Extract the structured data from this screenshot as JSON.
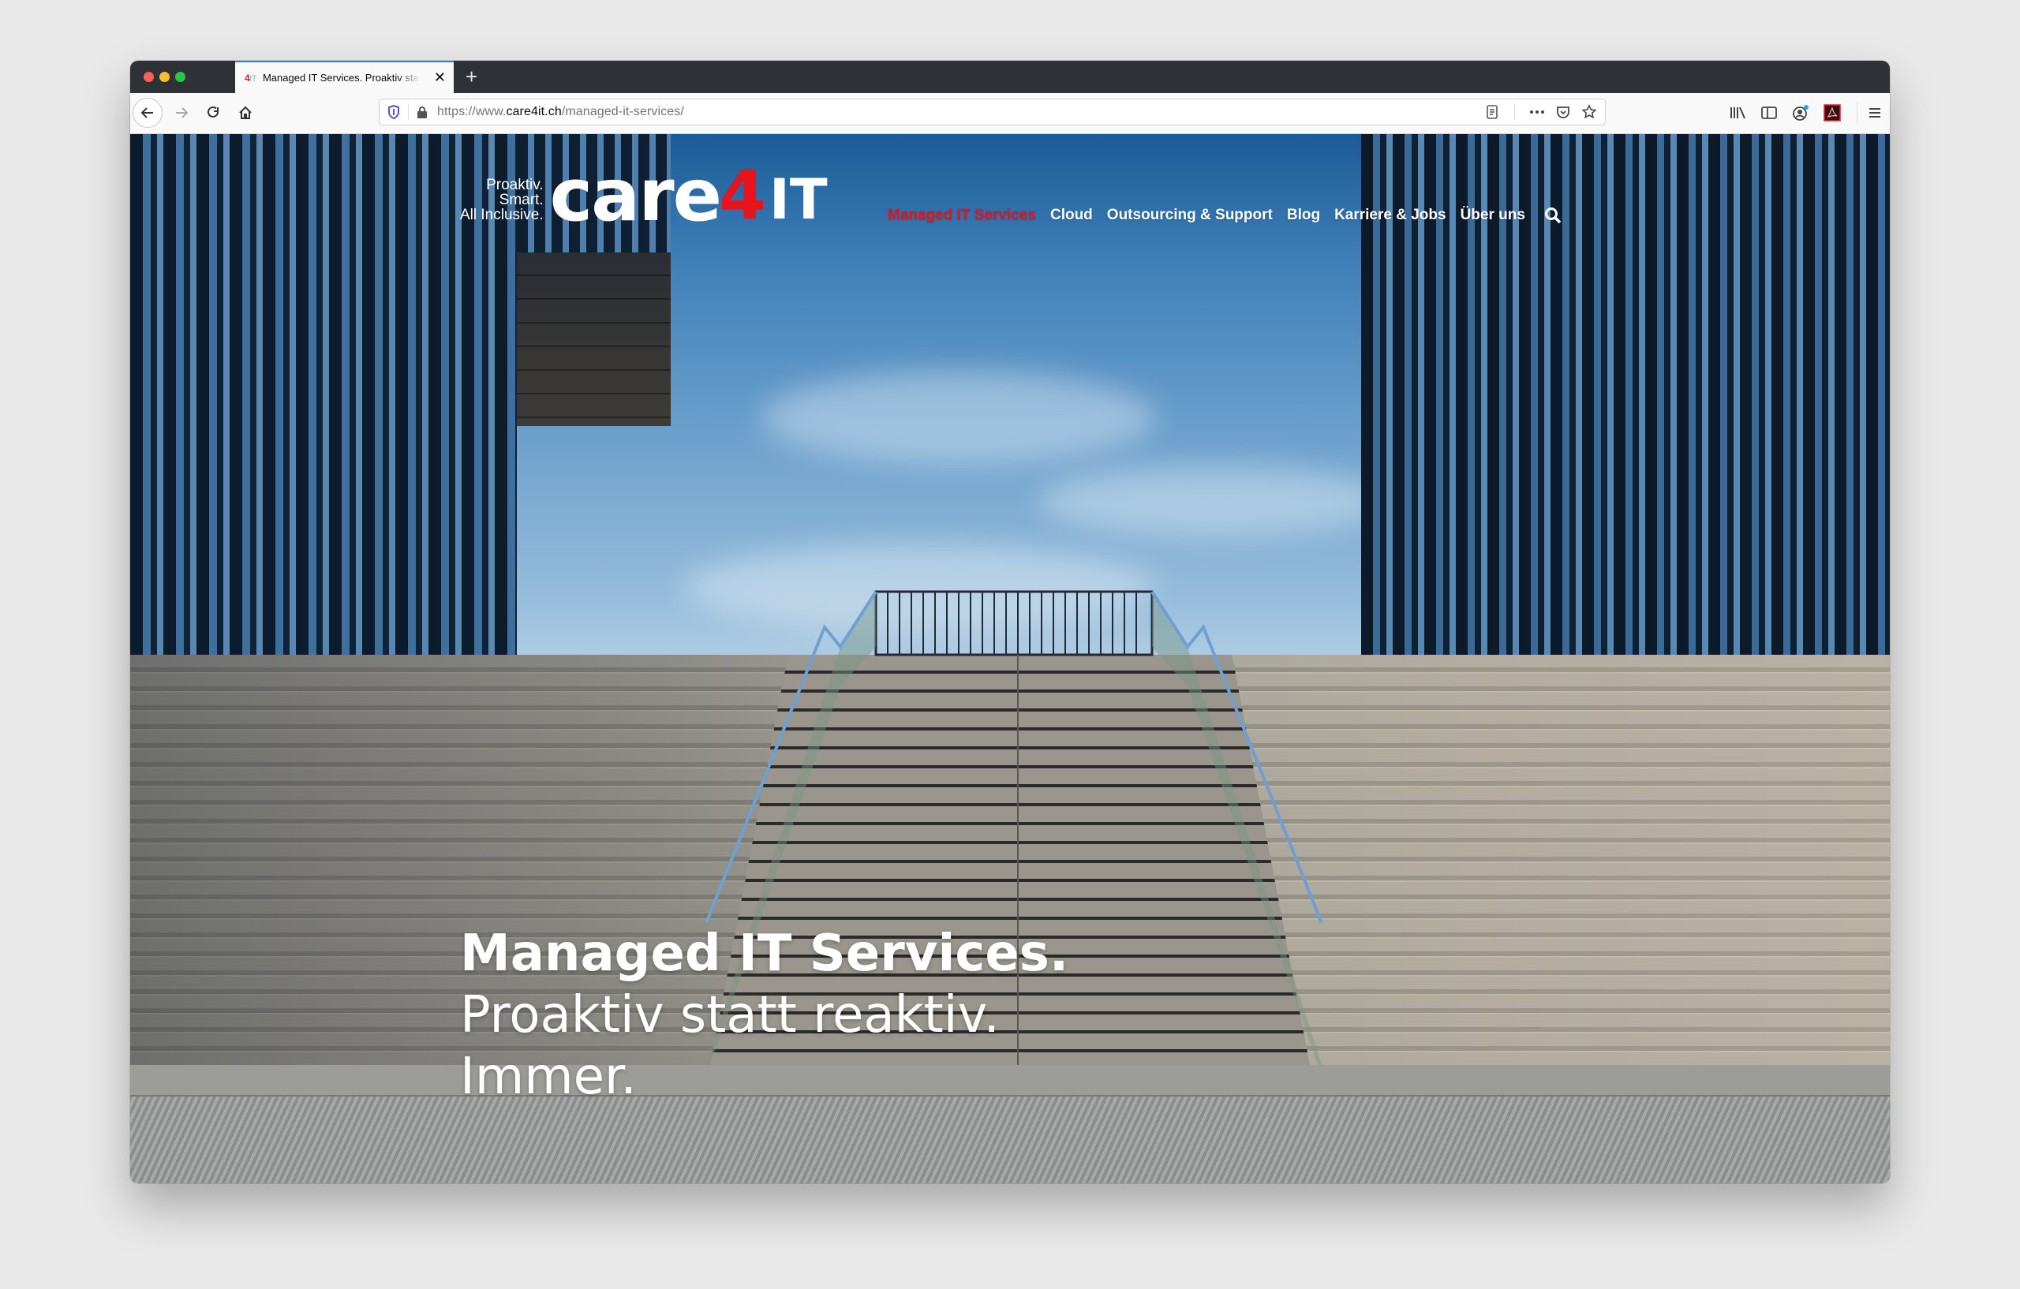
{
  "browser": {
    "tab": {
      "favicon_four": "4",
      "favicon_it": "IT",
      "title": "Managed IT Services. Proaktiv statt reaktiv. Immer."
    },
    "new_tab_label": "+",
    "close_label": "✕",
    "url": {
      "prefix": "https://www.",
      "domain": "care4it.ch",
      "path": "/managed-it-services/"
    }
  },
  "site": {
    "logo": {
      "tagline": [
        "Proaktiv.",
        "Smart.",
        "All Inclusive."
      ],
      "care": "care",
      "four": "4",
      "it": "IT"
    },
    "nav": [
      {
        "label": "Managed IT Services",
        "active": true
      },
      {
        "label": "Cloud",
        "active": false
      },
      {
        "label": "Outsourcing & Support",
        "active": false
      },
      {
        "label": "Blog",
        "active": false
      },
      {
        "label": "Karriere & Jobs",
        "active": false
      },
      {
        "label": "Über uns",
        "active": false
      }
    ],
    "hero": {
      "line1": "Managed IT Services.",
      "line2": "Proaktiv statt reaktiv.",
      "line3": "Immer."
    },
    "colors": {
      "accent_red": "#e2141b",
      "tab_highlight": "#0a84ff"
    }
  }
}
